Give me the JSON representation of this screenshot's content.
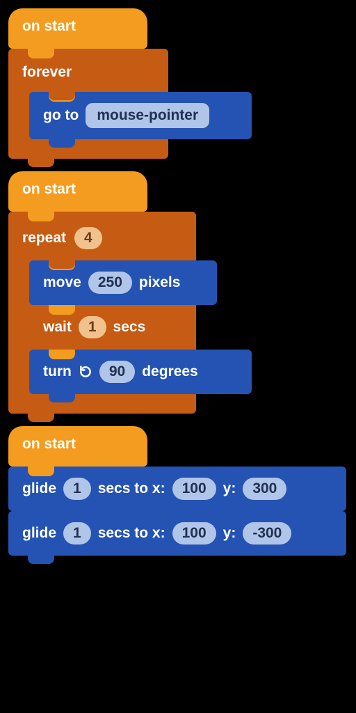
{
  "colors": {
    "event": "#f39c1f",
    "control": "#c65b14",
    "motion": "#2453b3",
    "input_motion": "#b1c5e8",
    "input_control": "#f1c28e"
  },
  "stacks": [
    {
      "hat": {
        "label": "on start"
      },
      "body": {
        "type": "c",
        "label": "forever",
        "children": [
          {
            "type": "motion",
            "parts": [
              "go to"
            ],
            "dropdown": "mouse-pointer"
          }
        ]
      }
    },
    {
      "hat": {
        "label": "on start"
      },
      "body": {
        "type": "c",
        "label": "repeat",
        "arg": "4",
        "children": [
          {
            "type": "motion",
            "parts": [
              "move",
              {
                "num": "250"
              },
              "pixels"
            ]
          },
          {
            "type": "control",
            "parts": [
              "wait",
              {
                "num": "1",
                "style": "ctrl"
              },
              "secs"
            ]
          },
          {
            "type": "motion",
            "parts": [
              "turn",
              {
                "icon": "rotate-cw"
              },
              {
                "num": "90"
              },
              "degrees"
            ]
          }
        ]
      }
    },
    {
      "hat": {
        "label": "on start"
      },
      "body": {
        "type": "seq",
        "children": [
          {
            "type": "motion",
            "parts": [
              "glide",
              {
                "num": "1"
              },
              "secs to x:",
              {
                "num": "100"
              },
              "y:",
              {
                "num": "300"
              }
            ]
          },
          {
            "type": "motion",
            "parts": [
              "glide",
              {
                "num": "1"
              },
              "secs to x:",
              {
                "num": "100"
              },
              "y:",
              {
                "num": "-300"
              }
            ]
          }
        ]
      }
    }
  ],
  "labels": {
    "on_start": "on start",
    "forever": "forever",
    "repeat": "repeat",
    "repeat_count": "4",
    "go_to": "go to",
    "mouse_pointer": "mouse-pointer",
    "move": "move",
    "move_val": "250",
    "pixels": "pixels",
    "wait": "wait",
    "wait_val": "1",
    "secs": "secs",
    "turn": "turn",
    "turn_val": "90",
    "degrees": "degrees",
    "glide": "glide",
    "glide1_secs": "1",
    "glide_secs_to_x": "secs to x:",
    "glide1_x": "100",
    "glide_y": "y:",
    "glide1_y": "300",
    "glide2_secs": "1",
    "glide2_x": "100",
    "glide2_y": "-300"
  }
}
